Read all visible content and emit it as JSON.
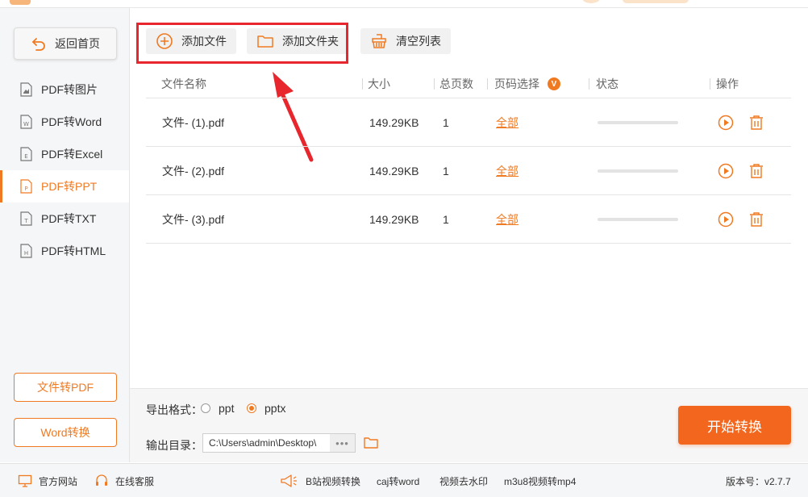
{
  "sidebar": {
    "back_label": "返回首页",
    "items": [
      {
        "label": "PDF转图片",
        "icon": "image-file-icon",
        "active": false
      },
      {
        "label": "PDF转Word",
        "icon": "word-file-icon",
        "active": false
      },
      {
        "label": "PDF转Excel",
        "icon": "excel-file-icon",
        "active": false
      },
      {
        "label": "PDF转PPT",
        "icon": "ppt-file-icon",
        "active": true
      },
      {
        "label": "PDF转TXT",
        "icon": "txt-file-icon",
        "active": false
      },
      {
        "label": "PDF转HTML",
        "icon": "html-file-icon",
        "active": false
      }
    ],
    "file_to_pdf_label": "文件转PDF",
    "word_convert_label": "Word转换"
  },
  "toolbar": {
    "add_file_label": "添加文件",
    "add_folder_label": "添加文件夹",
    "clear_list_label": "清空列表"
  },
  "table": {
    "headers": {
      "name": "文件名称",
      "size": "大小",
      "pages": "总页数",
      "page_select": "页码选择",
      "page_select_badge": "V",
      "status": "状态",
      "actions": "操作"
    },
    "rows": [
      {
        "name": "文件- (1).pdf",
        "size": "149.29KB",
        "pages": "1",
        "page_select": "全部",
        "progress": 0
      },
      {
        "name": "文件- (2).pdf",
        "size": "149.29KB",
        "pages": "1",
        "page_select": "全部",
        "progress": 0
      },
      {
        "name": "文件- (3).pdf",
        "size": "149.29KB",
        "pages": "1",
        "page_select": "全部",
        "progress": 0
      }
    ]
  },
  "output": {
    "format_label": "导出格式：",
    "format_options": [
      "ppt",
      "pptx"
    ],
    "format_selected": "pptx",
    "dir_label": "输出目录：",
    "dir_value": "C:\\Users\\admin\\Desktop\\",
    "more_label": "•••",
    "start_label": "开始转换"
  },
  "statusbar": {
    "website": "官方网站",
    "support": "在线客服",
    "promo_links": [
      "B站视频转换",
      "caj转word",
      "视频去水印",
      "m3u8视频转mp4"
    ],
    "version": "版本号：v2.7.7"
  },
  "colors": {
    "accent": "#f07a22",
    "start_button": "#f3661d",
    "highlight_box": "#e8262d"
  }
}
